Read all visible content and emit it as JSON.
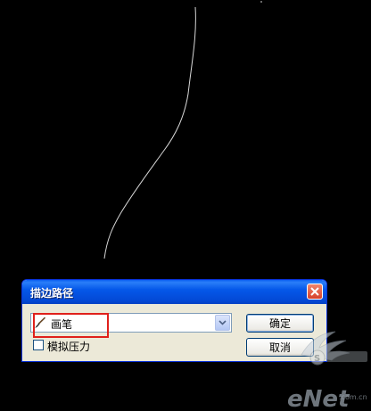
{
  "dialog": {
    "title": "描边路径",
    "tool_value": "画笔",
    "simulate_pressure_label": "模拟压力",
    "simulate_pressure_checked": false,
    "ok_label": "确定",
    "cancel_label": "取消"
  },
  "watermark": {
    "logo_text": "eNet"
  },
  "icons": {
    "brush": "brush-icon",
    "close": "close-icon",
    "dropdown": "chevron-down-icon"
  },
  "colors": {
    "background": "#000000",
    "titlebar": "#0558e9",
    "dialog_body": "#ece9d8",
    "highlight": "#e0201b",
    "path_stroke": "#d8d8d8"
  }
}
